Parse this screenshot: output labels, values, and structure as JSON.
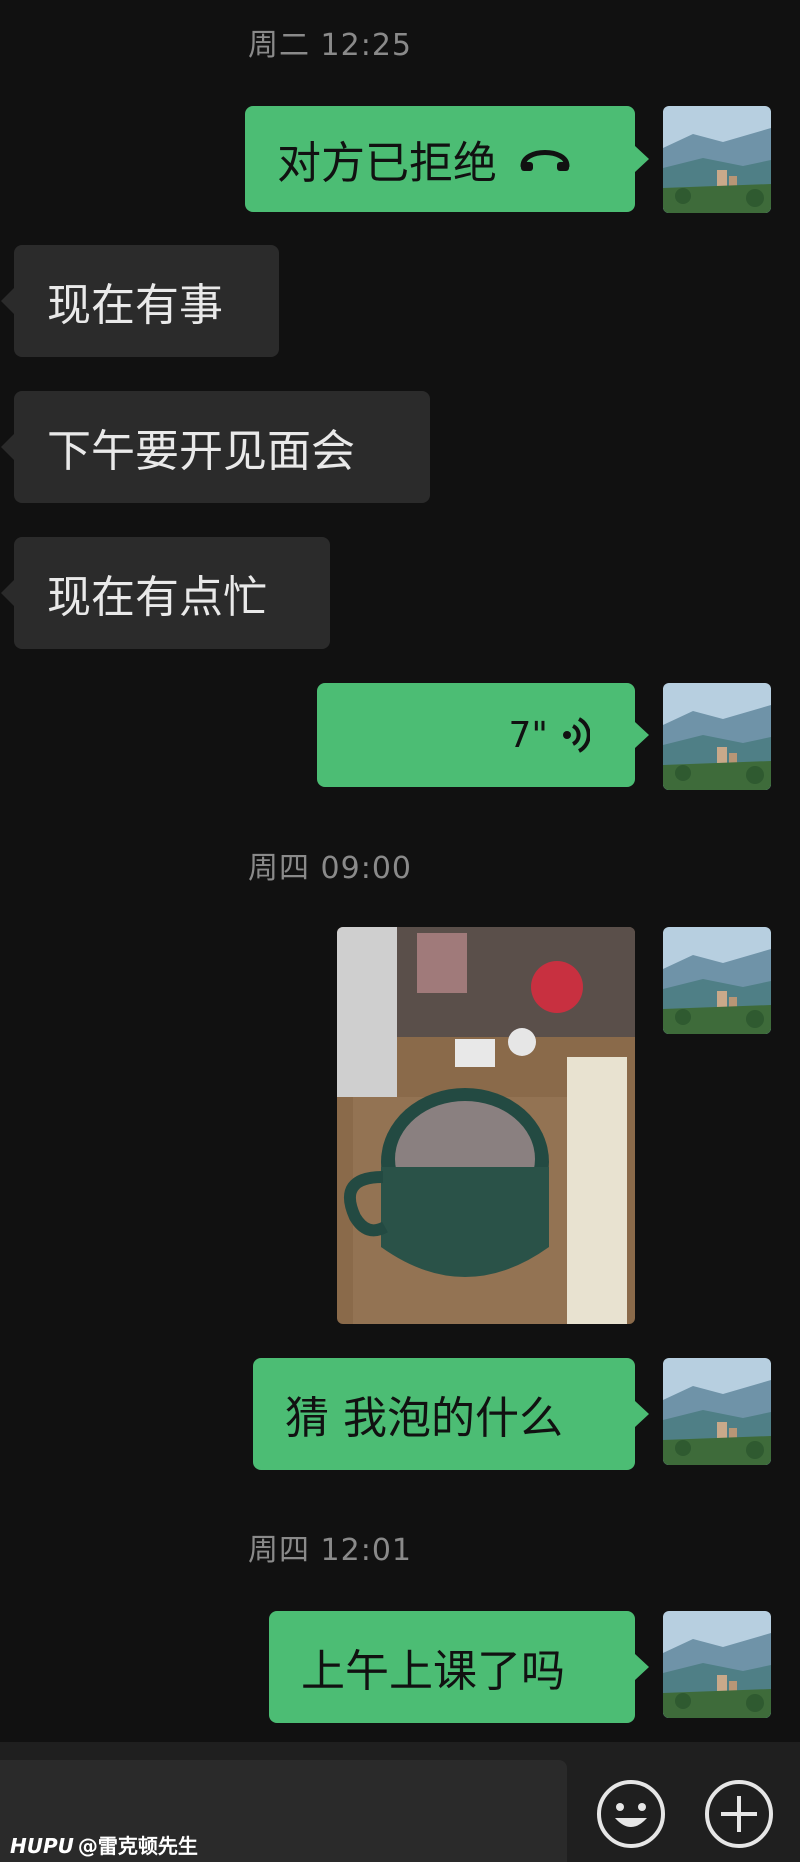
{
  "messages": {
    "ts1": "周二 12:25",
    "call_rejected": "对方已拒绝",
    "in1": "现在有事",
    "in2": "下午要开见面会",
    "in3": "现在有点忙",
    "voice_duration": "7\"",
    "ts2": "周四 09:00",
    "out_guess": "猜 我泡的什么",
    "ts3": "周四 12:01",
    "out_class": "上午上课了吗"
  },
  "icons": {
    "call_rejected": "phone-hangup-icon",
    "voice": "voice-wave-icon",
    "emoji": "emoji-icon",
    "plus": "plus-icon"
  },
  "colors": {
    "background": "#111111",
    "outgoing_bubble": "#4cbd74",
    "incoming_bubble": "#2b2b2b"
  },
  "watermark": {
    "brand": "HUPU",
    "user": "@雷克顿先生"
  }
}
